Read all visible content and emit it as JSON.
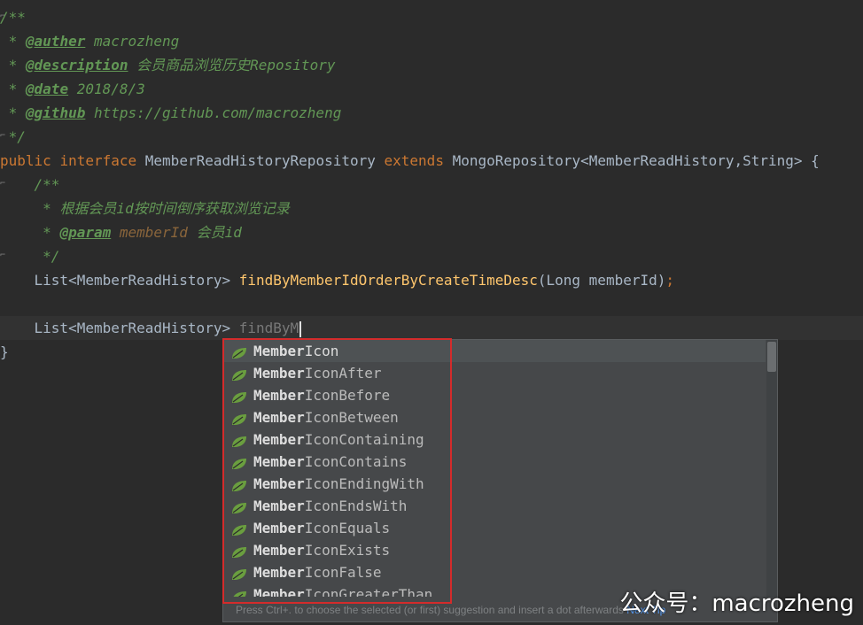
{
  "editor": {
    "lines": {
      "l1": "/**",
      "l2_prefix": " * ",
      "l2_tag": "@auther",
      "l2_text": " macrozheng",
      "l3_prefix": " * ",
      "l3_tag": "@description",
      "l3_text": " 会员商品浏览历史Repository",
      "l4_prefix": " * ",
      "l4_tag": "@date",
      "l4_text": " 2018/8/3",
      "l5_prefix": " * ",
      "l5_tag": "@github",
      "l5_text": " https://github.com/macrozheng",
      "l6": " */",
      "l7_kw1": "public",
      "l7_kw2": "interface",
      "l7_name": "MemberReadHistoryRepository",
      "l7_kw3": "extends",
      "l7_rest": "MongoRepository<MemberReadHistory,String> {",
      "l8": "    /**",
      "l9": "     * 根据会员id按时间倒序获取浏览记录",
      "l10_prefix": "     * ",
      "l10_tag": "@param",
      "l10_param": " memberId",
      "l10_text": " 会员id",
      "l11": "     */",
      "l12_type": "    List<MemberReadHistory> ",
      "l12_fn": "findByMemberIdOrderByCreateTimeDesc",
      "l12_args": "(Long memberId)",
      "l12_semi": ";",
      "l14_type": "    List<MemberReadHistory> ",
      "l14_typed": "findByM",
      "l15": "}"
    }
  },
  "completion": {
    "items": [
      {
        "prefix": "Member",
        "rest": "Icon"
      },
      {
        "prefix": "Member",
        "rest": "IconAfter"
      },
      {
        "prefix": "Member",
        "rest": "IconBefore"
      },
      {
        "prefix": "Member",
        "rest": "IconBetween"
      },
      {
        "prefix": "Member",
        "rest": "IconContaining"
      },
      {
        "prefix": "Member",
        "rest": "IconContains"
      },
      {
        "prefix": "Member",
        "rest": "IconEndingWith"
      },
      {
        "prefix": "Member",
        "rest": "IconEndsWith"
      },
      {
        "prefix": "Member",
        "rest": "IconEquals"
      },
      {
        "prefix": "Member",
        "rest": "IconExists"
      },
      {
        "prefix": "Member",
        "rest": "IconFalse"
      },
      {
        "prefix": "Member",
        "rest": "IconGreaterThan"
      }
    ],
    "item_icon": "spring-data-leaf-icon",
    "hint_text": "Press Ctrl+. to choose the selected (or first) suggestion and insert a dot afterwards",
    "hint_tip": "Next Tip"
  },
  "watermark": "公众号：macrozheng",
  "colors": {
    "background": "#2b2b2b",
    "keyword": "#cc7832",
    "doc_comment": "#629755",
    "function": "#ffc66d",
    "highlight_box": "#d42b2b"
  }
}
